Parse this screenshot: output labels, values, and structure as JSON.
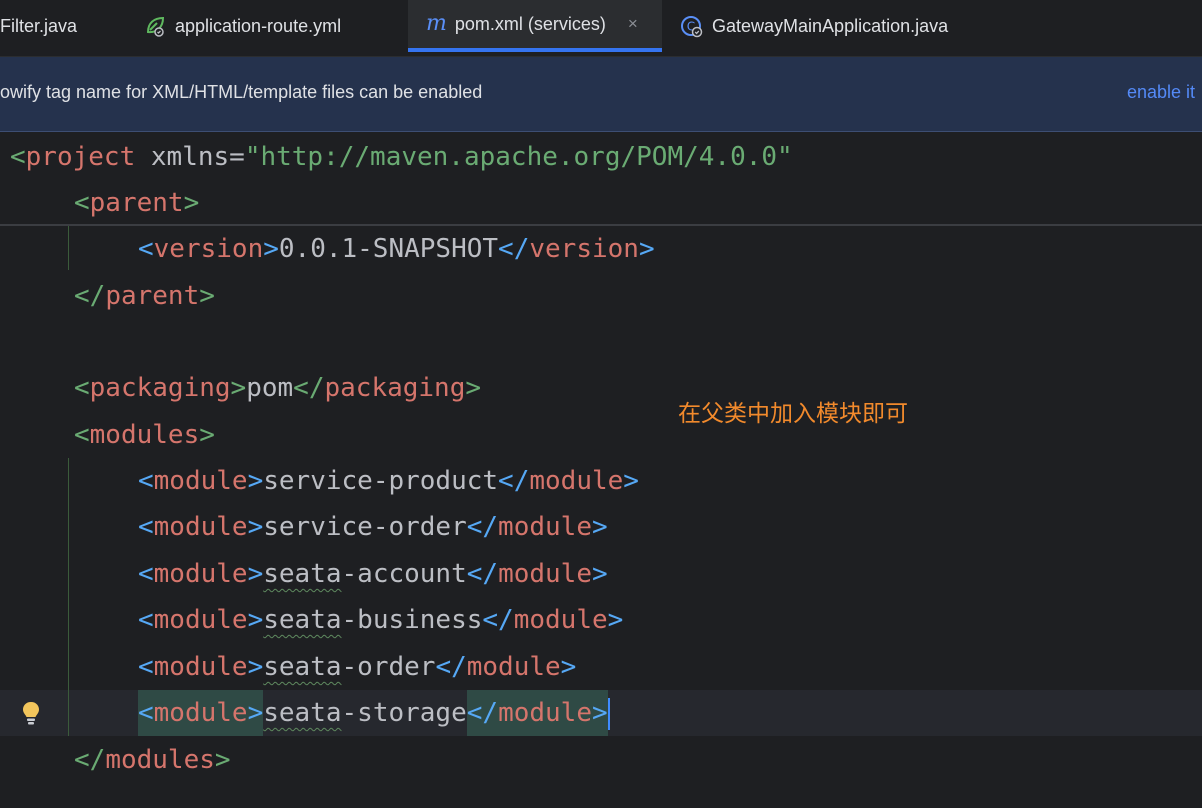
{
  "tabs": [
    {
      "label": "Filter.java",
      "icon": "java-class-icon",
      "active": false
    },
    {
      "label": "application-route.yml",
      "icon": "yaml-spring-icon",
      "active": false
    },
    {
      "label": "pom.xml (services)",
      "icon": "maven-icon",
      "active": true
    },
    {
      "label": "GatewayMainApplication.java",
      "icon": "spring-class-icon",
      "active": false
    }
  ],
  "tab_close_glyph": "×",
  "banner": {
    "message": "owify tag name for XML/HTML/template files can be enabled",
    "action": "enable it"
  },
  "code": {
    "project_open": {
      "open": "<",
      "name": "project",
      "attr": " xmlns=",
      "value": "\"http://maven.apache.org/POM/4.0.0\""
    },
    "parent_open": {
      "open": "<",
      "name": "parent",
      "close": ">"
    },
    "version_line": {
      "tag": "version",
      "value": "0.0.1-SNAPSHOT"
    },
    "parent_close": {
      "open": "</",
      "name": "parent",
      "close": ">"
    },
    "packaging_line": {
      "tag": "packaging",
      "value": "pom"
    },
    "modules_open": {
      "open": "<",
      "name": "modules",
      "close": ">"
    },
    "modules": [
      {
        "prefix": "service",
        "suffix": "-product",
        "typo": false
      },
      {
        "prefix": "service",
        "suffix": "-order",
        "typo": false
      },
      {
        "prefix": "seata",
        "suffix": "-account",
        "typo": true
      },
      {
        "prefix": "seata",
        "suffix": "-business",
        "typo": true
      },
      {
        "prefix": "seata",
        "suffix": "-order",
        "typo": true
      },
      {
        "prefix": "seata",
        "suffix": "-storage",
        "typo": true
      }
    ],
    "module_tag": "module",
    "modules_close": {
      "open": "</",
      "name": "modules",
      "close": ">"
    }
  },
  "annotation": "在父类中加入模块即可",
  "colors": {
    "tag_name": "#d5756c",
    "bracket": "#56a8f5",
    "string": "#6aab73",
    "annotation": "#f28a2c",
    "accent": "#3574f0"
  }
}
